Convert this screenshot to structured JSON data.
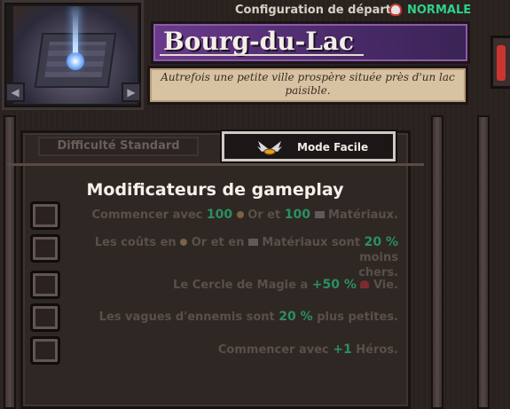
{
  "header": {
    "config_label": "Configuration de départ :",
    "difficulty_value": "NORMALE"
  },
  "level": {
    "title": "Bourg-du-Lac",
    "description": "Autrefois une petite ville prospère située près d'un lac paisible."
  },
  "tabs": {
    "standard": "Difficulté Standard",
    "easy": "Mode Facile"
  },
  "modifiers": {
    "title": "Modificateurs de gameplay",
    "rows": [
      {
        "a": "Commencer avec ",
        "n1": "100",
        "b": " Or et ",
        "n2": "100",
        "c": " Matériaux."
      },
      {
        "a": "Les coûts en ",
        "b": " Or et en ",
        "c": " Matériaux sont ",
        "n1": "20 %",
        "d": " moins",
        "e": "chers."
      },
      {
        "a": "Le Cercle de Magie a ",
        "n1": "+50 %",
        "b": " Vie."
      },
      {
        "a": "Les vagues d'ennemis sont ",
        "n1": "20 %",
        "b": " plus petites."
      },
      {
        "a": "Commencer avec ",
        "n1": "+1",
        "b": " Héros."
      }
    ]
  },
  "colors": {
    "accent_green": "#2fd08a",
    "banner_purple": "#6a3a8a",
    "parchment": "#d7c2a2"
  },
  "icons": [
    "skull-icon",
    "gold-coin-icon",
    "materials-icon",
    "heart-icon",
    "wings-icon",
    "arrow-left-icon",
    "arrow-right-icon"
  ]
}
